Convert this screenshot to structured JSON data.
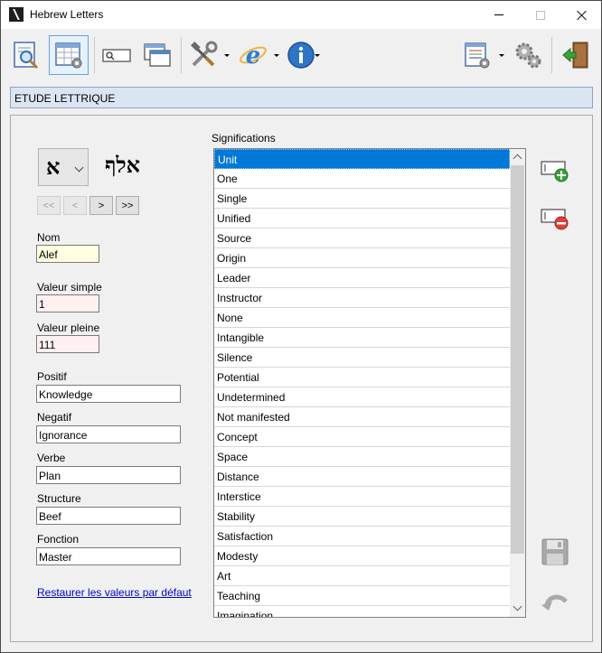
{
  "window": {
    "title": "Hebrew Letters"
  },
  "toolbar": {
    "items": [
      {
        "icon": "search-document-icon"
      },
      {
        "icon": "table-settings-icon"
      },
      {
        "icon": "textbox-search-icon"
      },
      {
        "icon": "windows-icon"
      },
      {
        "icon": "tools-icon"
      },
      {
        "icon": "internet-explorer-icon"
      },
      {
        "icon": "info-icon"
      },
      {
        "icon": "list-settings-icon"
      },
      {
        "icon": "gears-icon"
      },
      {
        "icon": "exit-door-icon"
      }
    ]
  },
  "section": {
    "title": "ETUDE LETTRIQUE"
  },
  "letter": {
    "selected": "א",
    "word": "אלף"
  },
  "navigation": {
    "first": "<<",
    "prev": "<",
    "next": ">",
    "last": ">>"
  },
  "fields": {
    "nom": {
      "label": "Nom",
      "value": "Alef"
    },
    "valeur_simple": {
      "label": "Valeur simple",
      "value": "1"
    },
    "valeur_pleine": {
      "label": "Valeur pleine",
      "value": "111"
    },
    "positif": {
      "label": "Positif",
      "value": "Knowledge"
    },
    "negatif": {
      "label": "Negatif",
      "value": "Ignorance"
    },
    "verbe": {
      "label": "Verbe",
      "value": "Plan"
    },
    "structure": {
      "label": "Structure",
      "value": "Beef"
    },
    "fonction": {
      "label": "Fonction",
      "value": "Master"
    }
  },
  "restore_link": "Restaurer les valeurs par défaut",
  "significations": {
    "label": "Significations",
    "selected_index": 0,
    "items": [
      "Unit",
      "One",
      "Single",
      "Unified",
      "Source",
      "Origin",
      "Leader",
      "Instructor",
      "None",
      "Intangible",
      "Silence",
      "Potential",
      "Undetermined",
      "Not manifested",
      "Concept",
      "Space",
      "Distance",
      "Interstice",
      "Stability",
      "Satisfaction",
      "Modesty",
      "Art",
      "Teaching",
      "Imagination"
    ]
  },
  "colors": {
    "accent": "#0078d7",
    "header_band": "#dbe5f1",
    "name_field": "#ffffe1",
    "value_fields": "#fff0f2",
    "link": "#0000cc"
  }
}
